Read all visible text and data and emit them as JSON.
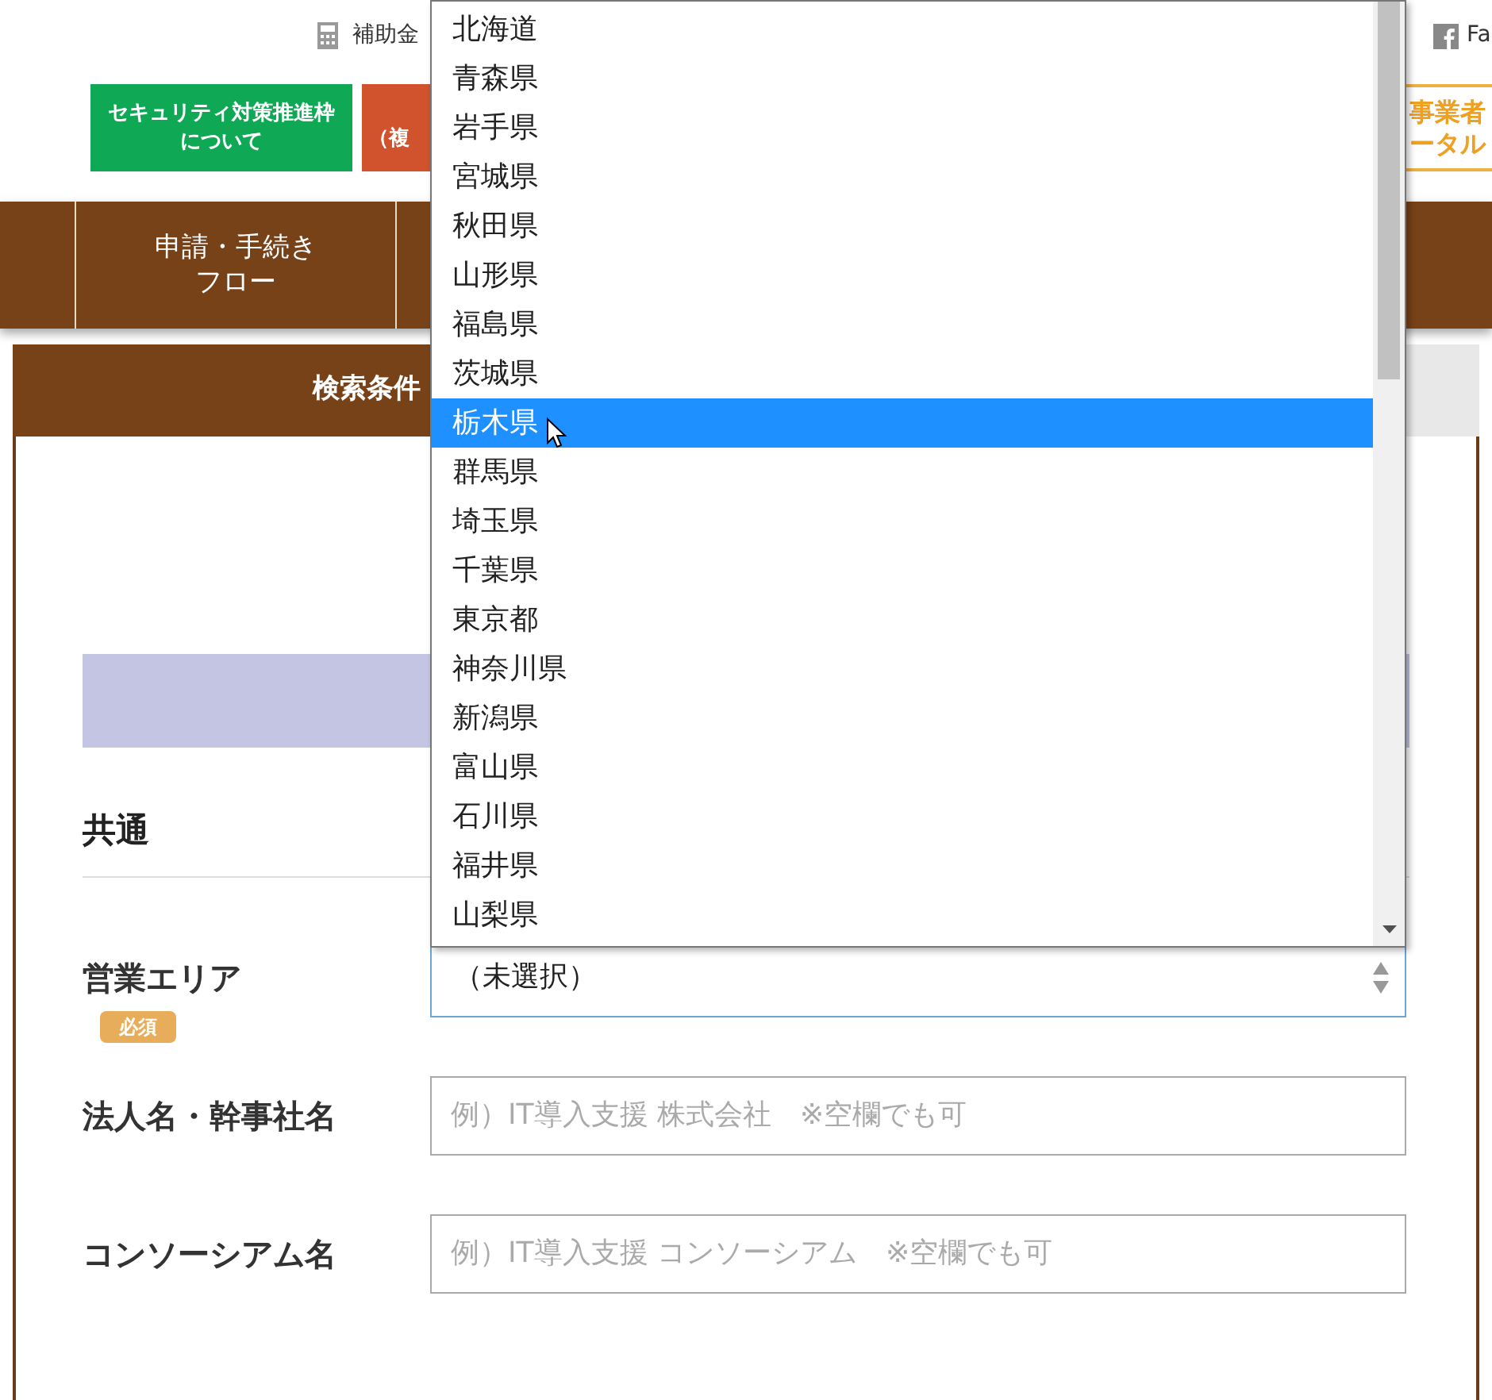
{
  "top_bar": {
    "link": "補助金",
    "social": "Fa"
  },
  "banners": [
    {
      "kind": "green",
      "label": "セキュリティ対策推進枠について"
    },
    {
      "kind": "orange",
      "label": "（複"
    },
    {
      "kind": "outline",
      "label": "事業者ータル"
    }
  ],
  "nav": [
    {
      "label": "申請・手続きフロー"
    }
  ],
  "search_tabs": [
    {
      "label": "検索条件",
      "selected": true
    },
    {
      "selected": false
    }
  ],
  "form": {
    "section": "共通",
    "required_badge": "必須",
    "fields": [
      {
        "label": "営業エリア",
        "kind": "select",
        "required": true,
        "value": "（未選択）"
      },
      {
        "label": "法人名・幹事社名",
        "kind": "text",
        "required": false,
        "placeholder": "例）IT導入支援 株式会社　※空欄でも可"
      },
      {
        "label": "コンソーシアム名",
        "kind": "text",
        "required": false,
        "placeholder": "例）IT導入支援 コンソーシアム　※空欄でも可"
      }
    ]
  },
  "dropdown": {
    "options": [
      {
        "label": "北海道",
        "selected": false
      },
      {
        "label": "青森県",
        "selected": false
      },
      {
        "label": "岩手県",
        "selected": false
      },
      {
        "label": "宮城県",
        "selected": false
      },
      {
        "label": "秋田県",
        "selected": false
      },
      {
        "label": "山形県",
        "selected": false
      },
      {
        "label": "福島県",
        "selected": false
      },
      {
        "label": "茨城県",
        "selected": false
      },
      {
        "label": "栃木県",
        "selected": true
      },
      {
        "label": "群馬県",
        "selected": false
      },
      {
        "label": "埼玉県",
        "selected": false
      },
      {
        "label": "千葉県",
        "selected": false
      },
      {
        "label": "東京都",
        "selected": false
      },
      {
        "label": "神奈川県",
        "selected": false
      },
      {
        "label": "新潟県",
        "selected": false
      },
      {
        "label": "富山県",
        "selected": false
      },
      {
        "label": "石川県",
        "selected": false
      },
      {
        "label": "福井県",
        "selected": false
      },
      {
        "label": "山梨県",
        "selected": false
      }
    ]
  }
}
